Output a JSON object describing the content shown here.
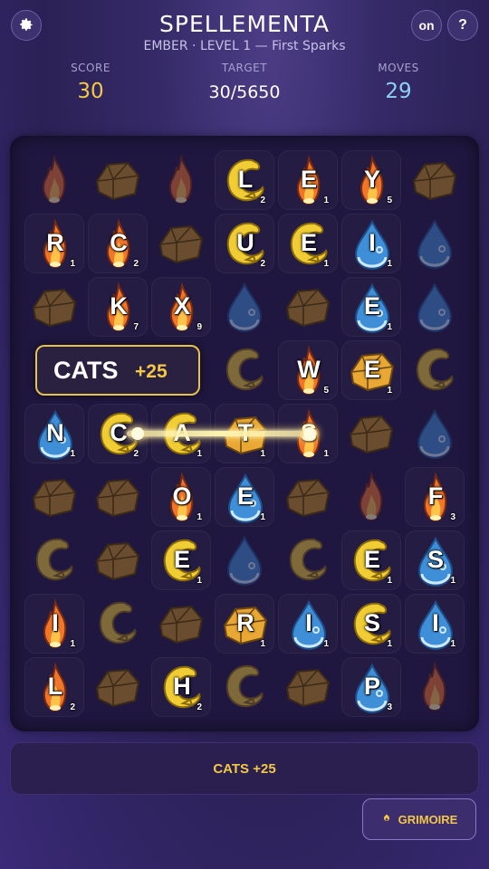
{
  "header": {
    "settings_icon": "gear-icon",
    "title": "SPELLEMENTA",
    "subtitle": "EMBER  ·  LEVEL 1 — First Sparks",
    "sound_label": "on",
    "help_label": "?"
  },
  "stats": {
    "score_label": "SCORE",
    "score": "30",
    "target_label": "TARGET",
    "target": "30/5650",
    "moves_label": "MOVES",
    "moves": "29",
    "score_color": "#f4c846",
    "moves_color": "#8ed0f5"
  },
  "board": {
    "cols": 7,
    "rows": 9,
    "cells": [
      [
        {
          "t": "fire",
          "f": 1
        },
        {
          "t": "rock"
        },
        {
          "t": "fire",
          "f": 1
        },
        {
          "t": "air",
          "l": "L",
          "n": "2",
          "s": 1
        },
        {
          "t": "fire",
          "l": "E",
          "n": "1",
          "s": 1
        },
        {
          "t": "fire",
          "l": "Y",
          "n": "5",
          "s": 1
        },
        {
          "t": "rock"
        }
      ],
      [
        {
          "t": "fire",
          "l": "R",
          "n": "1",
          "s": 1
        },
        {
          "t": "fire",
          "l": "C",
          "n": "2",
          "s": 1
        },
        {
          "t": "rock"
        },
        {
          "t": "air",
          "l": "U",
          "n": "2",
          "s": 1
        },
        {
          "t": "air",
          "l": "E",
          "n": "1",
          "s": 1
        },
        {
          "t": "water",
          "l": "I",
          "n": "1",
          "s": 1
        },
        {
          "t": "water",
          "f": 1
        }
      ],
      [
        {
          "t": "rock"
        },
        {
          "t": "fire",
          "l": "K",
          "n": "7",
          "s": 1
        },
        {
          "t": "fire",
          "l": "X",
          "n": "9",
          "s": 1
        },
        {
          "t": "water",
          "f": 1
        },
        {
          "t": "rock"
        },
        {
          "t": "water",
          "l": "E",
          "n": "1",
          "s": 1
        },
        {
          "t": "water",
          "f": 1
        }
      ],
      [
        {
          "t": "none"
        },
        {
          "t": "none"
        },
        {
          "t": "none"
        },
        {
          "t": "air",
          "f": 1
        },
        {
          "t": "fire",
          "l": "W",
          "n": "5",
          "s": 1
        },
        {
          "t": "gold",
          "l": "E",
          "n": "1",
          "s": 1
        },
        {
          "t": "air",
          "f": 1
        }
      ],
      [
        {
          "t": "water",
          "l": "N",
          "n": "1",
          "s": 1
        },
        {
          "t": "air",
          "l": "C",
          "n": "2",
          "s": 1,
          "g": 1
        },
        {
          "t": "air",
          "l": "A",
          "n": "1",
          "s": 1,
          "g": 1
        },
        {
          "t": "gold",
          "l": "T",
          "n": "1",
          "s": 1,
          "g": 1
        },
        {
          "t": "fire",
          "l": "S",
          "n": "1",
          "s": 1,
          "g": 1
        },
        {
          "t": "rock"
        },
        {
          "t": "water",
          "f": 1
        }
      ],
      [
        {
          "t": "rock"
        },
        {
          "t": "rock"
        },
        {
          "t": "fire",
          "l": "O",
          "n": "1",
          "s": 1
        },
        {
          "t": "water",
          "l": "E",
          "n": "1",
          "s": 1
        },
        {
          "t": "rock"
        },
        {
          "t": "fire",
          "f": 1
        },
        {
          "t": "fire",
          "l": "F",
          "n": "3",
          "s": 1
        }
      ],
      [
        {
          "t": "air",
          "f": 1
        },
        {
          "t": "rock"
        },
        {
          "t": "air",
          "l": "E",
          "n": "1",
          "s": 1
        },
        {
          "t": "water",
          "f": 1
        },
        {
          "t": "air",
          "f": 1
        },
        {
          "t": "air",
          "l": "E",
          "n": "1",
          "s": 1
        },
        {
          "t": "water",
          "l": "S",
          "n": "1",
          "s": 1
        }
      ],
      [
        {
          "t": "fire",
          "l": "I",
          "n": "1",
          "s": 1
        },
        {
          "t": "air",
          "f": 1
        },
        {
          "t": "rock"
        },
        {
          "t": "gold",
          "l": "R",
          "n": "1",
          "s": 1
        },
        {
          "t": "water",
          "l": "I",
          "n": "1",
          "s": 1
        },
        {
          "t": "air",
          "l": "S",
          "n": "1",
          "s": 1
        },
        {
          "t": "water",
          "l": "I",
          "n": "1",
          "s": 1
        }
      ],
      [
        {
          "t": "fire",
          "l": "L",
          "n": "2",
          "s": 1
        },
        {
          "t": "rock"
        },
        {
          "t": "air",
          "l": "H",
          "n": "2",
          "s": 1
        },
        {
          "t": "air",
          "f": 1
        },
        {
          "t": "rock"
        },
        {
          "t": "water",
          "l": "P",
          "n": "3",
          "s": 1
        },
        {
          "t": "fire",
          "f": 1
        }
      ]
    ]
  },
  "popup": {
    "word": "CATS",
    "points": "+25"
  },
  "history": {
    "entry": "CATS  +25"
  },
  "grimoire": {
    "label": "GRIMOIRE",
    "icon": "spellbook-icon"
  },
  "colors": {
    "fire": "#f0762a",
    "water": "#3f8fd8",
    "air": "#f1cd35",
    "rock": "#6a4d2f",
    "gold": "#e9a733",
    "accent": "#f4c846"
  }
}
